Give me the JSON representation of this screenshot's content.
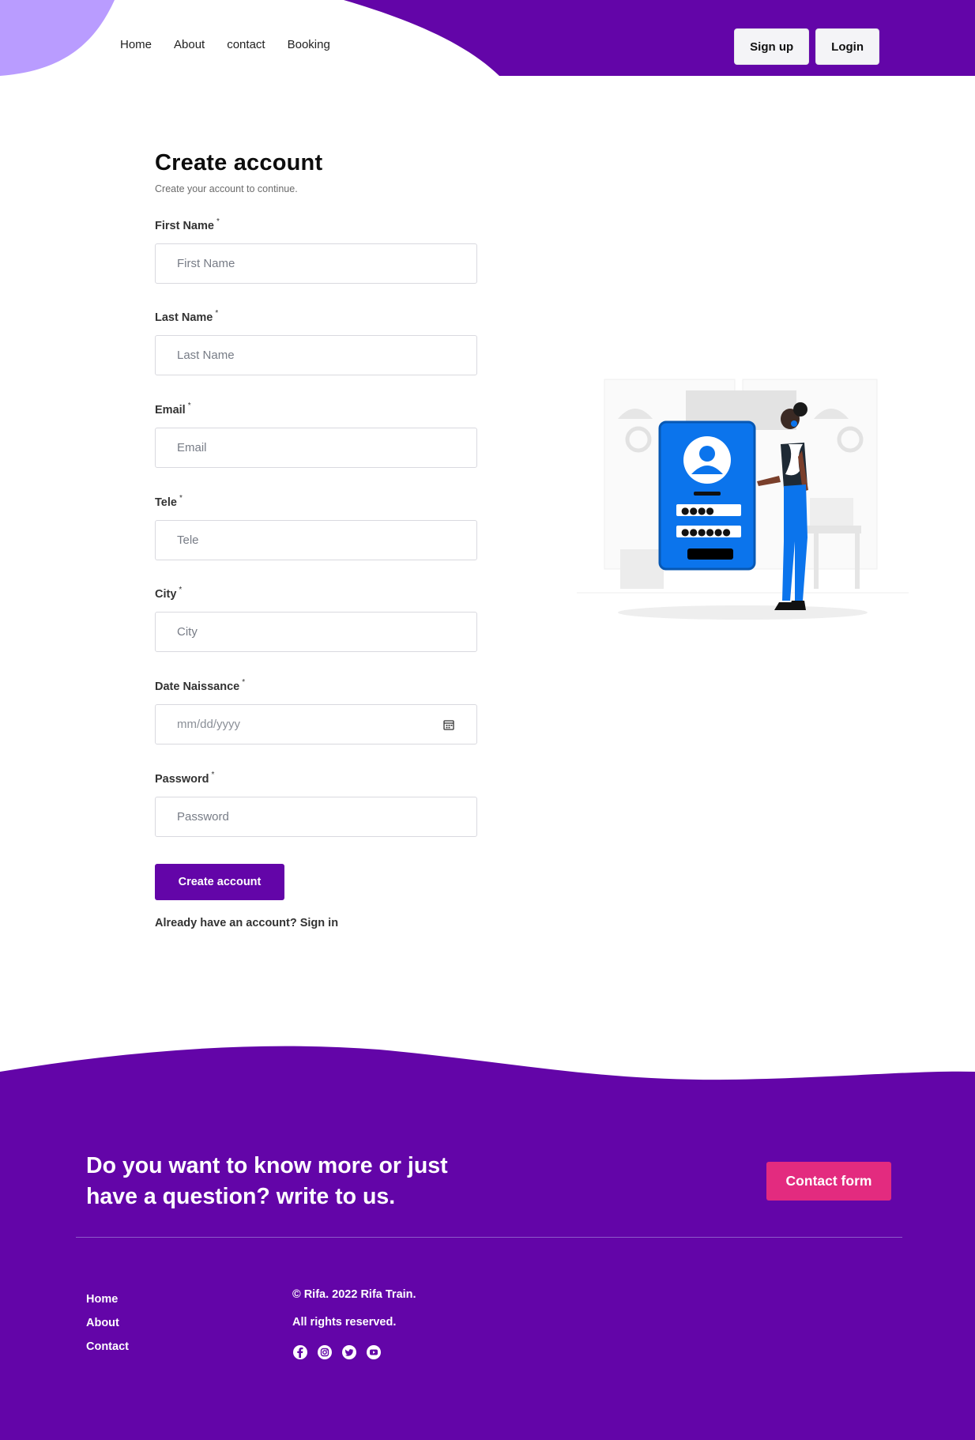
{
  "nav": {
    "items": [
      "Home",
      "About",
      "contact",
      "Booking"
    ]
  },
  "auth": {
    "signup": "Sign up",
    "login": "Login"
  },
  "form": {
    "title": "Create account",
    "subtitle": "Create your account to continue.",
    "required_mark": "*",
    "fields": [
      {
        "label": "First Name",
        "placeholder": "First Name"
      },
      {
        "label": "Last Name",
        "placeholder": "Last Name"
      },
      {
        "label": "Email",
        "placeholder": "Email"
      },
      {
        "label": "Tele",
        "placeholder": "Tele"
      },
      {
        "label": "City",
        "placeholder": "City"
      },
      {
        "label": "Date Naissance",
        "placeholder": "mm/dd/yyyy"
      },
      {
        "label": "Password",
        "placeholder": "Password"
      }
    ],
    "submit": "Create account",
    "signin_prompt": "Already have an account? Sign in"
  },
  "footer": {
    "cta": "Do you want to know more or just have a question? write to us.",
    "contact_button": "Contact form",
    "links": [
      "Home",
      "About",
      "Contact"
    ],
    "copyright": "© Rifa. 2022 Rifa Train.",
    "rights": "All rights reserved.",
    "socials": [
      "facebook-icon",
      "instagram-icon",
      "twitter-icon",
      "youtube-icon"
    ]
  },
  "colors": {
    "brand": "#6305a8",
    "accent_light": "#b99cff",
    "cta_pink": "#e32b7f",
    "illustration_blue": "#0b74ec"
  }
}
